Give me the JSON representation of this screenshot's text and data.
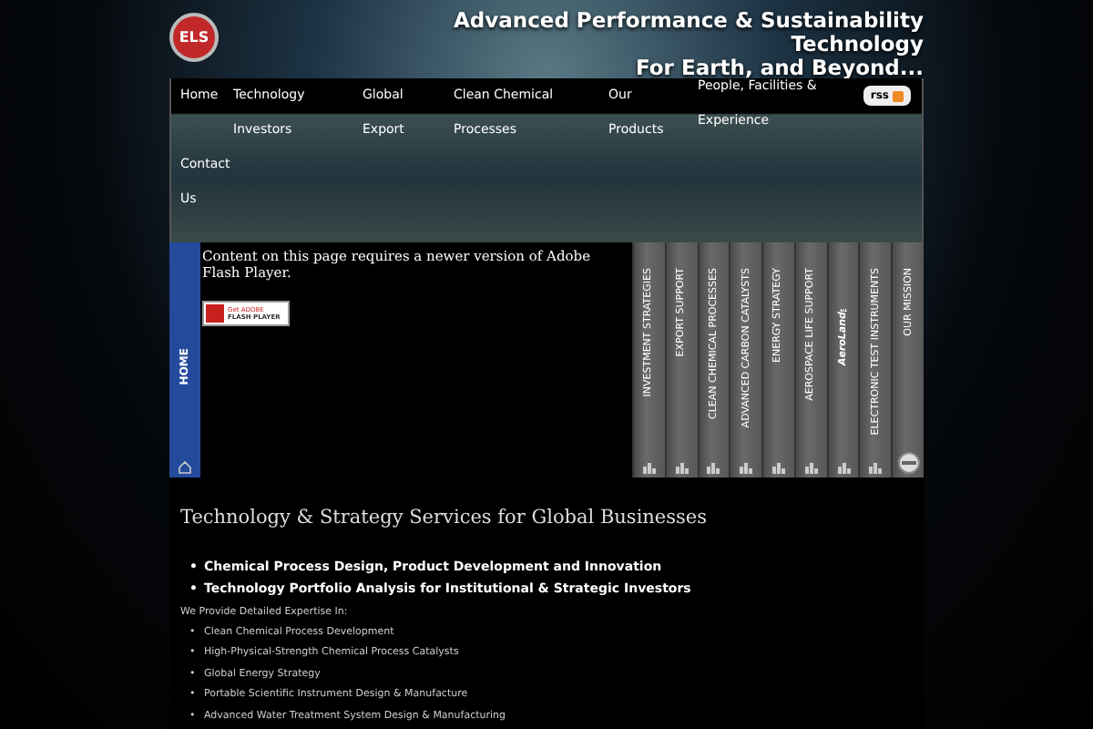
{
  "header": {
    "logo_text": "ELS",
    "tagline": [
      "Advanced Performance & Sustainability",
      "Technology",
      "For Earth, and Beyond..."
    ]
  },
  "nav": {
    "items": [
      {
        "lines": [
          "Home"
        ]
      },
      {
        "lines": [
          "Technology",
          "Investors"
        ]
      },
      {
        "lines": [
          "Global",
          "Export"
        ]
      },
      {
        "lines": [
          "Clean Chemical",
          "Processes"
        ]
      },
      {
        "lines": [
          "Our",
          "Products"
        ]
      },
      {
        "lines": [
          "People, Facilities &",
          "Experience"
        ]
      },
      {
        "lines": [
          "Contact",
          "Us"
        ]
      }
    ],
    "rss": "rss"
  },
  "side_tab": {
    "label": "HOME"
  },
  "flash": {
    "message": "Content on this page requires a newer version of Adobe Flash Player.",
    "badge_small": "Get ADOBE",
    "badge_main": "FLASH PLAYER"
  },
  "accordion": [
    {
      "label": "INVESTMENT STRATEGIES",
      "emphasized": false
    },
    {
      "label": "EXPORT SUPPORT",
      "emphasized": false
    },
    {
      "label": "CLEAN CHEMICAL PROCESSES",
      "emphasized": false
    },
    {
      "label": "ADVANCED CARBON CATALYSTS",
      "emphasized": false
    },
    {
      "label": "ENERGY STRATEGY",
      "emphasized": false
    },
    {
      "label": "AEROSPACE LIFE SUPPORT",
      "emphasized": false
    },
    {
      "label": "AeroLand™",
      "emphasized": true
    },
    {
      "label": "ELECTRONIC TEST INSTRUMENTS",
      "emphasized": false
    },
    {
      "label": "OUR MISSION",
      "emphasized": false
    }
  ],
  "content": {
    "heading": "Technology & Strategy Services for Global Businesses",
    "highlights": [
      "Chemical Process Design, Product Development and Innovation",
      "Technology Portfolio Analysis for Institutional & Strategic Investors"
    ],
    "intro": "We Provide Detailed Expertise In:",
    "bullet": "•",
    "expertise": [
      "Clean Chemical Process Development",
      "High-Physical-Strength Chemical Process Catalysts",
      "Global Energy Strategy",
      "Portable Scientific Instrument Design & Manufacture",
      "Advanced Water Treatment System Design & Manufacturing"
    ]
  }
}
